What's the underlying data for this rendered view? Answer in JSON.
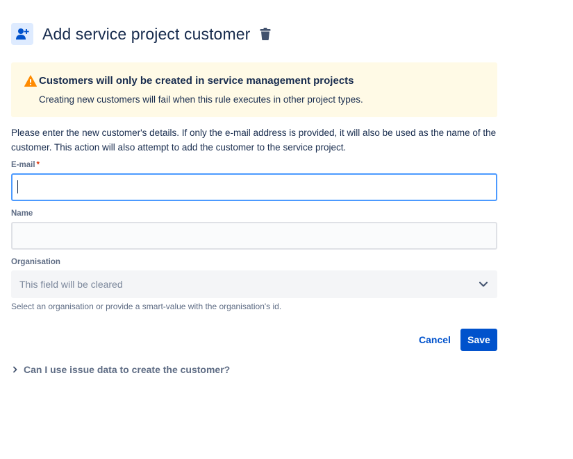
{
  "header": {
    "title": "Add service project customer",
    "icon": "add-user-icon",
    "delete_icon": "trash-icon"
  },
  "warning": {
    "icon": "warning-icon",
    "title": "Customers will only be created in service management projects",
    "body": "Creating new customers will fail when this rule executes in other project types."
  },
  "description": "Please enter the new customer's details. If only the e-mail address is provided, it will also be used as the name of the customer. This action will also attempt to add the customer to the service project.",
  "form": {
    "email": {
      "label": "E-mail",
      "required_mark": "*",
      "value": ""
    },
    "name": {
      "label": "Name",
      "value": ""
    },
    "organisation": {
      "label": "Organisation",
      "selected": "This field will be cleared",
      "helper": "Select an organisation or provide a smart-value with the organisation's id."
    }
  },
  "actions": {
    "cancel_label": "Cancel",
    "save_label": "Save"
  },
  "expander": {
    "label": "Can I use issue data to create the customer?"
  },
  "colors": {
    "primary": "#0052cc",
    "warning_bg": "#fffae6",
    "warning_icon": "#ff8b00",
    "focus_border": "#4c9aff",
    "text": "#172b4d",
    "subtle_text": "#5e6c84"
  }
}
